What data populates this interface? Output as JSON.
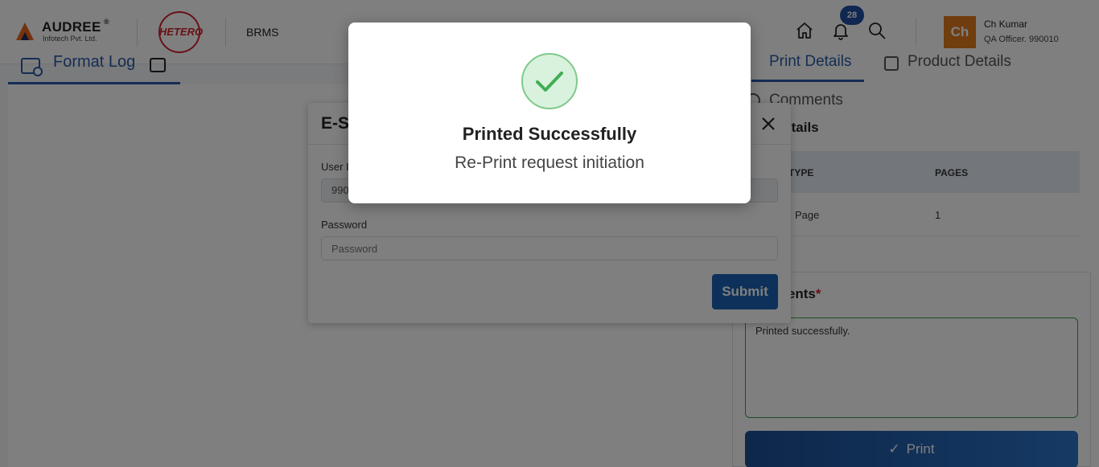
{
  "header": {
    "brand_name": "AUDREE",
    "brand_reg": "®",
    "brand_sub": "Infotech Pvt. Ltd.",
    "partner_logo": "HETERO",
    "app_name": "BRMS",
    "notification_count": "28",
    "icons": [
      "home-icon",
      "bell-icon",
      "search-icon"
    ],
    "user": {
      "initials": "Ch",
      "name": "Ch Kumar",
      "role": "QA Officer. 990010"
    },
    "colors": {
      "avatar": "#e07a1f",
      "badge": "#1f4fa3"
    }
  },
  "left_tab": {
    "label": "Format Log"
  },
  "right_panel": {
    "tabs": {
      "print_details": "Print Details",
      "product_details": "Product Details"
    },
    "comments_label": "Comments",
    "section_title": "Log Details",
    "table": {
      "headers": [
        "TYPE",
        "PAGES"
      ],
      "rows": [
        {
          "type": "Page",
          "pages": "1"
        }
      ]
    },
    "comments_field_label": "Comments",
    "comments_required": "*",
    "comments_value": "Printed successfully.",
    "print_button": "Print"
  },
  "esign_modal": {
    "title": "E-S",
    "user_label": "User I",
    "user_value": "990",
    "password_label": "Password",
    "password_placeholder": "Password",
    "submit_label": "Submit"
  },
  "success_dialog": {
    "title": "Printed Successfully",
    "message": "Re-Print request initiation",
    "icon": "check-circle-icon",
    "colors": {
      "check": "#3fae55",
      "ring_fill": "#d9f2dd"
    }
  }
}
